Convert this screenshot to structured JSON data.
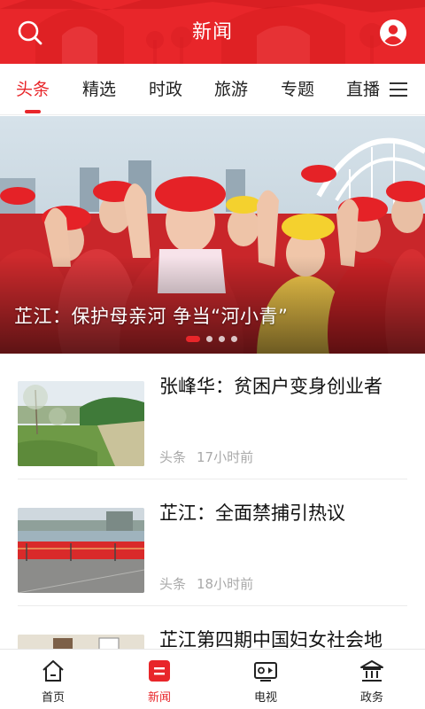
{
  "header": {
    "title": "新闻",
    "search_icon": "search-icon",
    "user_icon": "user-avatar-icon",
    "background_color": "#e8262a"
  },
  "tabs": [
    {
      "label": "头条",
      "active": true
    },
    {
      "label": "精选",
      "active": false
    },
    {
      "label": "时政",
      "active": false
    },
    {
      "label": "旅游",
      "active": false
    },
    {
      "label": "专题",
      "active": false
    },
    {
      "label": "直播",
      "active": false
    }
  ],
  "tabs_menu_icon": "menu-icon",
  "banner": {
    "caption": "芷江：保护母亲河 争当“河小青”",
    "slide_count": 4,
    "active_slide": 1
  },
  "news": [
    {
      "title": "张峰华：贫困户变身创业者",
      "category": "头条",
      "time": "17小时前"
    },
    {
      "title": "芷江：全面禁捕引热议",
      "category": "头条",
      "time": "18小时前"
    },
    {
      "title": "芷江第四期中国妇女社会地",
      "category": "",
      "time": ""
    }
  ],
  "bottom_nav": [
    {
      "label": "首页",
      "icon": "home-icon",
      "active": false
    },
    {
      "label": "新闻",
      "icon": "news-icon",
      "active": true
    },
    {
      "label": "电视",
      "icon": "tv-icon",
      "active": false
    },
    {
      "label": "政务",
      "icon": "government-icon",
      "active": false
    }
  ],
  "accent_color": "#e8262a"
}
